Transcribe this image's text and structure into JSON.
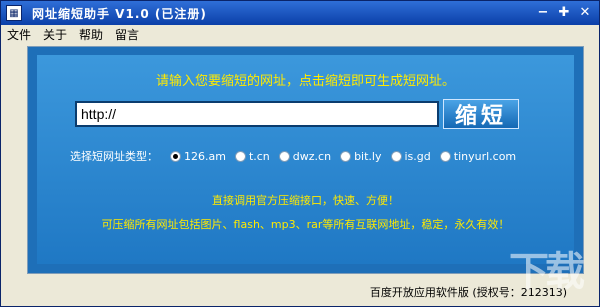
{
  "window": {
    "title": "网址缩短助手 V1.0 (已注册)",
    "icon": "app-icon",
    "buttons": {
      "minimize": "−",
      "maximize": "✚",
      "close": "✕"
    }
  },
  "menu": [
    "文件",
    "关于",
    "帮助",
    "留言"
  ],
  "main": {
    "heading": "请输入您要缩短的网址，点击缩短即可生成短网址。",
    "url_value": "http://",
    "shorten_label": "缩短",
    "type_label": "选择短网址类型：",
    "types": [
      {
        "label": "126.am",
        "checked": true
      },
      {
        "label": "t.cn",
        "checked": false
      },
      {
        "label": "dwz.cn",
        "checked": false
      },
      {
        "label": "bit.ly",
        "checked": false
      },
      {
        "label": "is.gd",
        "checked": false
      },
      {
        "label": "tinyurl.com",
        "checked": false
      }
    ],
    "info1": "直接调用官方压缩接口，快速、方便！",
    "info2": "可压缩所有网址包括图片、flash、mp3、rar等所有互联网地址，稳定，永久有效！"
  },
  "status": {
    "text": "百度开放应用软件版 (授权号：212313)"
  },
  "watermark": {
    "text": "下载吧"
  },
  "colors": {
    "title_bar": "#0b3fa8",
    "panel": "#2a88d0",
    "highlight_text": "#ffea00"
  }
}
